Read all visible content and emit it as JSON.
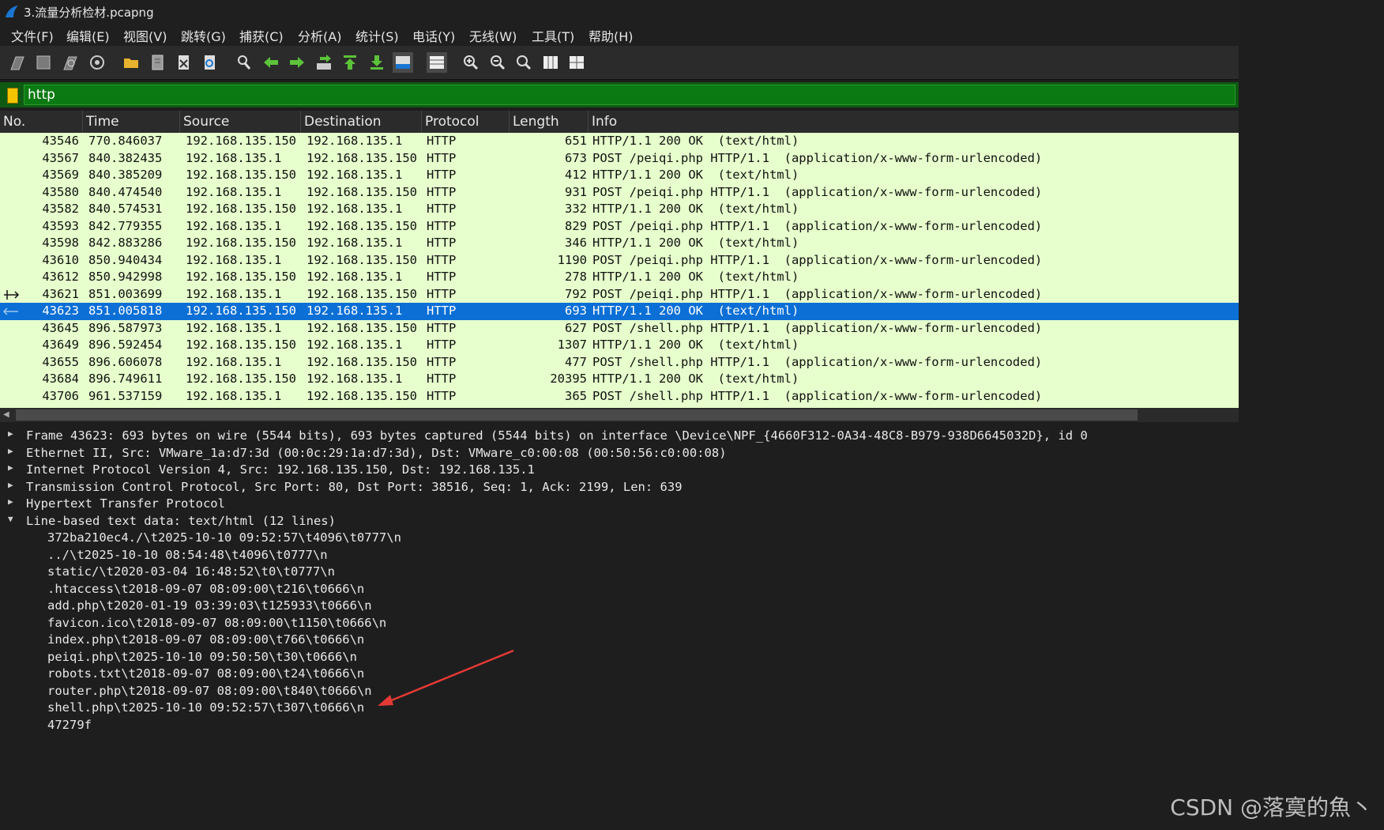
{
  "window": {
    "title": "3.流量分析检材.pcapng"
  },
  "menu": [
    "文件(F)",
    "编辑(E)",
    "视图(V)",
    "跳转(G)",
    "捕获(C)",
    "分析(A)",
    "统计(S)",
    "电话(Y)",
    "无线(W)",
    "工具(T)",
    "帮助(H)"
  ],
  "toolbar": {
    "icons": [
      "start-capture-icon",
      "stop-capture-icon",
      "restart-capture-icon",
      "capture-options-icon",
      "open-file-icon",
      "save-file-icon",
      "close-file-icon",
      "reload-file-icon",
      "find-packet-icon",
      "go-back-icon",
      "go-forward-icon",
      "go-to-packet-icon",
      "first-packet-icon",
      "last-packet-icon",
      "autoscroll-icon",
      "colorize-icon",
      "zoom-in-icon",
      "zoom-out-icon",
      "normal-size-icon",
      "resize-columns-icon",
      "layout-icon"
    ]
  },
  "filter": {
    "value": "http"
  },
  "columns": [
    "No.",
    "Time",
    "Source",
    "Destination",
    "Protocol",
    "Length",
    "Info"
  ],
  "packets": [
    {
      "no": "43546",
      "time": "770.846037",
      "src": "192.168.135.150",
      "dst": "192.168.135.1",
      "proto": "HTTP",
      "len": "651",
      "info": "HTTP/1.1 200 OK  (text/html)"
    },
    {
      "no": "43567",
      "time": "840.382435",
      "src": "192.168.135.1",
      "dst": "192.168.135.150",
      "proto": "HTTP",
      "len": "673",
      "info": "POST /peiqi.php HTTP/1.1  (application/x-www-form-urlencoded)"
    },
    {
      "no": "43569",
      "time": "840.385209",
      "src": "192.168.135.150",
      "dst": "192.168.135.1",
      "proto": "HTTP",
      "len": "412",
      "info": "HTTP/1.1 200 OK  (text/html)"
    },
    {
      "no": "43580",
      "time": "840.474540",
      "src": "192.168.135.1",
      "dst": "192.168.135.150",
      "proto": "HTTP",
      "len": "931",
      "info": "POST /peiqi.php HTTP/1.1  (application/x-www-form-urlencoded)"
    },
    {
      "no": "43582",
      "time": "840.574531",
      "src": "192.168.135.150",
      "dst": "192.168.135.1",
      "proto": "HTTP",
      "len": "332",
      "info": "HTTP/1.1 200 OK  (text/html)"
    },
    {
      "no": "43593",
      "time": "842.779355",
      "src": "192.168.135.1",
      "dst": "192.168.135.150",
      "proto": "HTTP",
      "len": "829",
      "info": "POST /peiqi.php HTTP/1.1  (application/x-www-form-urlencoded)"
    },
    {
      "no": "43598",
      "time": "842.883286",
      "src": "192.168.135.150",
      "dst": "192.168.135.1",
      "proto": "HTTP",
      "len": "346",
      "info": "HTTP/1.1 200 OK  (text/html)"
    },
    {
      "no": "43610",
      "time": "850.940434",
      "src": "192.168.135.1",
      "dst": "192.168.135.150",
      "proto": "HTTP",
      "len": "1190",
      "info": "POST /peiqi.php HTTP/1.1  (application/x-www-form-urlencoded)"
    },
    {
      "no": "43612",
      "time": "850.942998",
      "src": "192.168.135.150",
      "dst": "192.168.135.1",
      "proto": "HTTP",
      "len": "278",
      "info": "HTTP/1.1 200 OK  (text/html)"
    },
    {
      "no": "43621",
      "time": "851.003699",
      "src": "192.168.135.1",
      "dst": "192.168.135.150",
      "proto": "HTTP",
      "len": "792",
      "info": "POST /peiqi.php HTTP/1.1  (application/x-www-form-urlencoded)"
    },
    {
      "no": "43623",
      "time": "851.005818",
      "src": "192.168.135.150",
      "dst": "192.168.135.1",
      "proto": "HTTP",
      "len": "693",
      "info": "HTTP/1.1 200 OK  (text/html)",
      "selected": true
    },
    {
      "no": "43645",
      "time": "896.587973",
      "src": "192.168.135.1",
      "dst": "192.168.135.150",
      "proto": "HTTP",
      "len": "627",
      "info": "POST /shell.php HTTP/1.1  (application/x-www-form-urlencoded)"
    },
    {
      "no": "43649",
      "time": "896.592454",
      "src": "192.168.135.150",
      "dst": "192.168.135.1",
      "proto": "HTTP",
      "len": "1307",
      "info": "HTTP/1.1 200 OK  (text/html)"
    },
    {
      "no": "43655",
      "time": "896.606078",
      "src": "192.168.135.1",
      "dst": "192.168.135.150",
      "proto": "HTTP",
      "len": "477",
      "info": "POST /shell.php HTTP/1.1  (application/x-www-form-urlencoded)"
    },
    {
      "no": "43684",
      "time": "896.749611",
      "src": "192.168.135.150",
      "dst": "192.168.135.1",
      "proto": "HTTP",
      "len": "20395",
      "info": "HTTP/1.1 200 OK  (text/html)"
    },
    {
      "no": "43706",
      "time": "961.537159",
      "src": "192.168.135.1",
      "dst": "192.168.135.150",
      "proto": "HTTP",
      "len": "365",
      "info": "POST /shell.php HTTP/1.1  (application/x-www-form-urlencoded)"
    }
  ],
  "details": [
    {
      "text": "Frame 43623: 693 bytes on wire (5544 bits), 693 bytes captured (5544 bits) on interface \\Device\\NPF_{4660F312-0A34-48C8-B979-938D6645032D}, id 0",
      "expanded": false
    },
    {
      "text": "Ethernet II, Src: VMware_1a:d7:3d (00:0c:29:1a:d7:3d), Dst: VMware_c0:00:08 (00:50:56:c0:00:08)",
      "expanded": false
    },
    {
      "text": "Internet Protocol Version 4, Src: 192.168.135.150, Dst: 192.168.135.1",
      "expanded": false
    },
    {
      "text": "Transmission Control Protocol, Src Port: 80, Dst Port: 38516, Seq: 1, Ack: 2199, Len: 639",
      "expanded": false
    },
    {
      "text": "Hypertext Transfer Protocol",
      "expanded": false
    },
    {
      "text": "Line-based text data: text/html (12 lines)",
      "expanded": true
    }
  ],
  "text_lines": [
    "372ba210ec4./\\t2025-10-10 09:52:57\\t4096\\t0777\\n",
    "../\\t2025-10-10 08:54:48\\t4096\\t0777\\n",
    "static/\\t2020-03-04 16:48:52\\t0\\t0777\\n",
    ".htaccess\\t2018-09-07 08:09:00\\t216\\t0666\\n",
    "add.php\\t2020-01-19 03:39:03\\t125933\\t0666\\n",
    "favicon.ico\\t2018-09-07 08:09:00\\t1150\\t0666\\n",
    "index.php\\t2018-09-07 08:09:00\\t766\\t0666\\n",
    "peiqi.php\\t2025-10-10 09:50:50\\t30\\t0666\\n",
    "robots.txt\\t2018-09-07 08:09:00\\t24\\t0666\\n",
    "router.php\\t2018-09-07 08:09:00\\t840\\t0666\\n",
    "shell.php\\t2025-10-10 09:52:57\\t307\\t0666\\n",
    "47279f"
  ],
  "watermark": "CSDN @落寞的魚丶",
  "colors": {
    "list_bg": "#e6ffcc",
    "selected": "#0b6fd6",
    "filter_bg": "#0b7a12",
    "annotation_arrow": "#e53935"
  }
}
